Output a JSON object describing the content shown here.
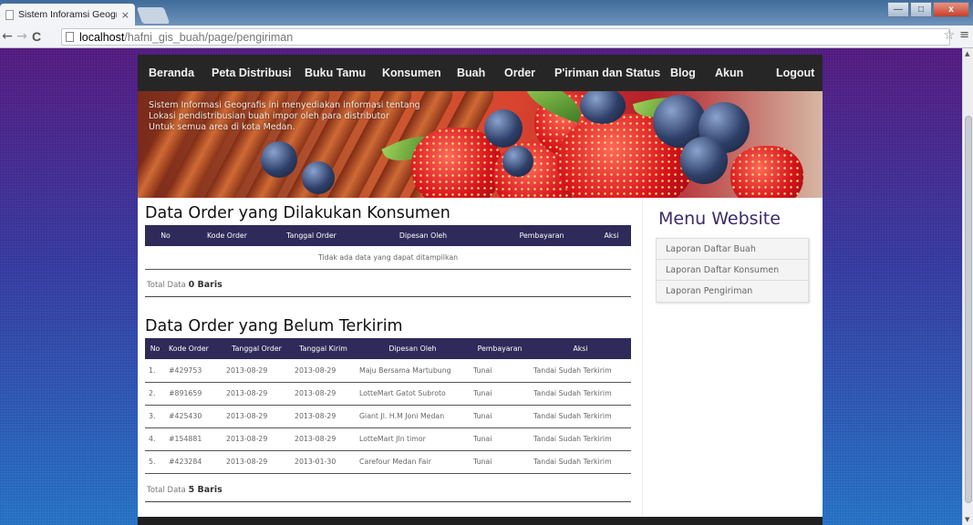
{
  "browser": {
    "tab_title": "Sistem Inforamsi Geografi",
    "tab_close": "×",
    "url_host": "localhost",
    "url_path": "/hafni_gis_buah/page/pengiriman",
    "back": "←",
    "forward": "→",
    "reload": "C",
    "star": "☆",
    "menu": "≡",
    "minimize": "—",
    "maximize": "□",
    "close": "x"
  },
  "nav": {
    "items": [
      "Beranda",
      "Peta Distribusi",
      "Buku Tamu",
      "Konsumen",
      "Buah",
      "Order",
      "P'iriman dan Status",
      "Blog",
      "Akun",
      "Logout"
    ]
  },
  "banner": {
    "lines": [
      "Sistem Informasi Geografis ini menyediakan informasi tentang",
      "Lokasi pendistribusian buah impor oleh para distributor",
      "Untuk semua area di kota Medan."
    ]
  },
  "order_dilakukan": {
    "title": "Data Order yang Dilakukan Konsumen",
    "columns": [
      "No",
      "Kode Order",
      "Tanggal Order",
      "Dipesan Oleh",
      "Pembayaran",
      "Aksi"
    ],
    "empty_message": "Tidak ada data yang dapat ditampilkan",
    "total_label": "Total Data",
    "total_count": "0 Baris"
  },
  "order_belum": {
    "title": "Data Order yang Belum Terkirim",
    "columns": [
      "No",
      "Kode Order",
      "Tanggal Order",
      "Tanggal Kirim",
      "Dipesan Oleh",
      "Pembayaran",
      "Aksi"
    ],
    "rows": [
      [
        "1.",
        "#429753",
        "2013-08-29",
        "2013-08-29",
        "Maju Bersama Martubung",
        "Tunai",
        "Tandai Sudah Terkirim"
      ],
      [
        "2.",
        "#891659",
        "2013-08-29",
        "2013-08-29",
        "LotteMart Gatot Subroto",
        "Tunai",
        "Tandai Sudah Terkirim"
      ],
      [
        "3.",
        "#425430",
        "2013-08-29",
        "2013-08-29",
        "Giant Jl. H.M Joni Medan",
        "Tunai",
        "Tandai Sudah Terkirim"
      ],
      [
        "4.",
        "#154881",
        "2013-08-29",
        "2013-08-29",
        "LotteMart Jln timor",
        "Tunai",
        "Tandai Sudah Terkirim"
      ],
      [
        "5.",
        "#423284",
        "2013-08-29",
        "2013-01-30",
        "Carefour Medan Fair",
        "Tunai",
        "Tandai Sudah Terkirim"
      ]
    ],
    "total_label": "Total Data",
    "total_count": "5 Baris"
  },
  "sidebar": {
    "title": "Menu Website",
    "items": [
      "Laporan Daftar Buah",
      "Laporan Daftar Konsumen",
      "Laporan Pengiriman"
    ]
  }
}
